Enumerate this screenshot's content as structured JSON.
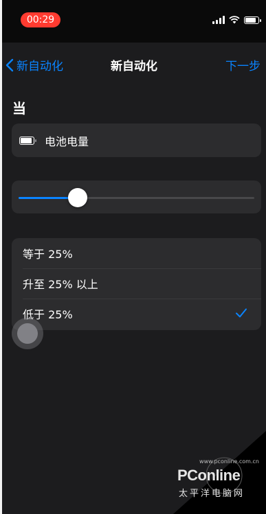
{
  "status_bar": {
    "time": "00:29",
    "icons": [
      "cellular-signal-icon",
      "wifi-icon",
      "battery-icon"
    ]
  },
  "nav": {
    "back_label": "新自动化",
    "title": "新自动化",
    "next_label": "下一步"
  },
  "section": {
    "label": "当"
  },
  "trigger": {
    "icon": "battery-icon",
    "label": "电池电量"
  },
  "slider": {
    "value_percent": 25
  },
  "options": [
    {
      "label": "等于 25%",
      "selected": false
    },
    {
      "label": "升至 25% 以上",
      "selected": false
    },
    {
      "label": "低于 25%",
      "selected": true
    }
  ],
  "watermark": {
    "brand": "PConline",
    "domain": "www.pconline.com.cn",
    "subtitle": "太平洋电脑网"
  },
  "colors": {
    "accent": "#0a84ff",
    "background": "#1c1c1e",
    "card": "#2c2c2e",
    "time_pill": "#ff3b30"
  }
}
